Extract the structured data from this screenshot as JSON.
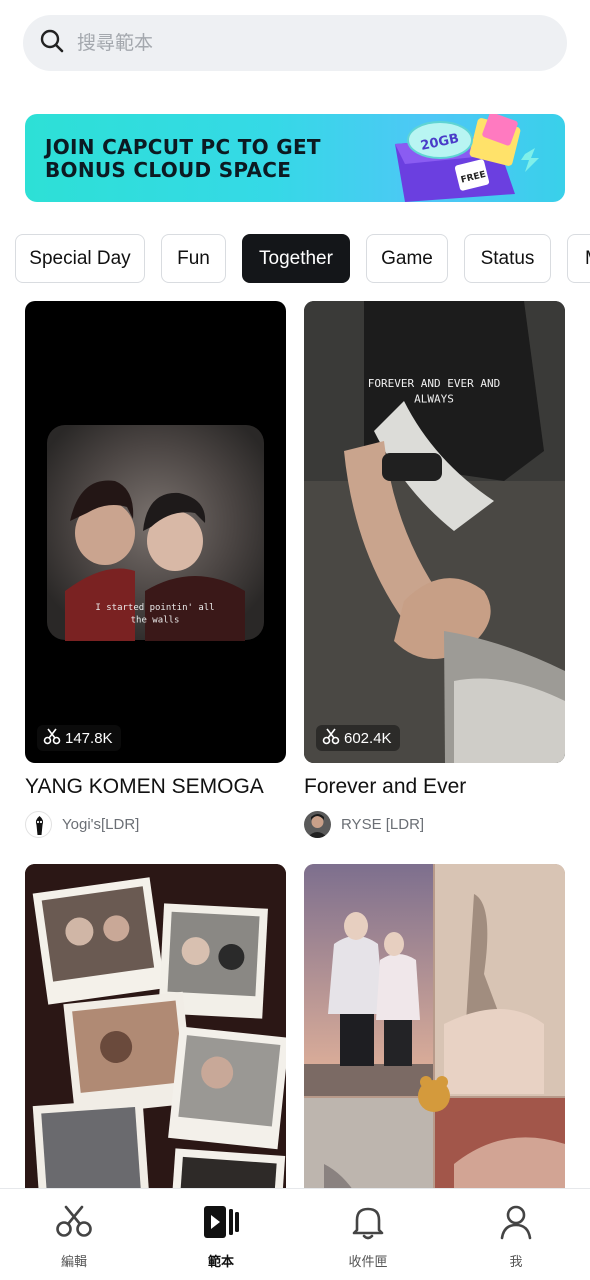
{
  "search": {
    "placeholder": "搜尋範本"
  },
  "banner": {
    "text": "JOIN CAPCUT PC TO GET BONUS CLOUD SPACE",
    "badge": "20GB",
    "tag": "FREE"
  },
  "chips": [
    "Special Day",
    "Fun",
    "Together",
    "Game",
    "Status",
    "M"
  ],
  "active_chip": "Together",
  "templates": [
    {
      "title": "YANG KOMEN SEMOGA",
      "author": "Yogi's[LDR]",
      "uses": "147.8K",
      "caption": "I started pointin' all the walls"
    },
    {
      "title": "Forever and Ever",
      "author": "RYSE [LDR]",
      "uses": "602.4K",
      "caption": "FOREVER AND EVER AND ALWAYS"
    },
    {
      "title": "",
      "author": "",
      "uses": ""
    },
    {
      "title": "",
      "author": "",
      "uses": ""
    }
  ],
  "nav": [
    {
      "label": "編輯",
      "icon": "scissors-icon"
    },
    {
      "label": "範本",
      "icon": "template-icon"
    },
    {
      "label": "收件匣",
      "icon": "bell-icon"
    },
    {
      "label": "我",
      "icon": "person-icon"
    }
  ],
  "colors": {
    "accent": "#141619",
    "banner": "#2de0d6",
    "search_bg": "#eef0f3"
  }
}
